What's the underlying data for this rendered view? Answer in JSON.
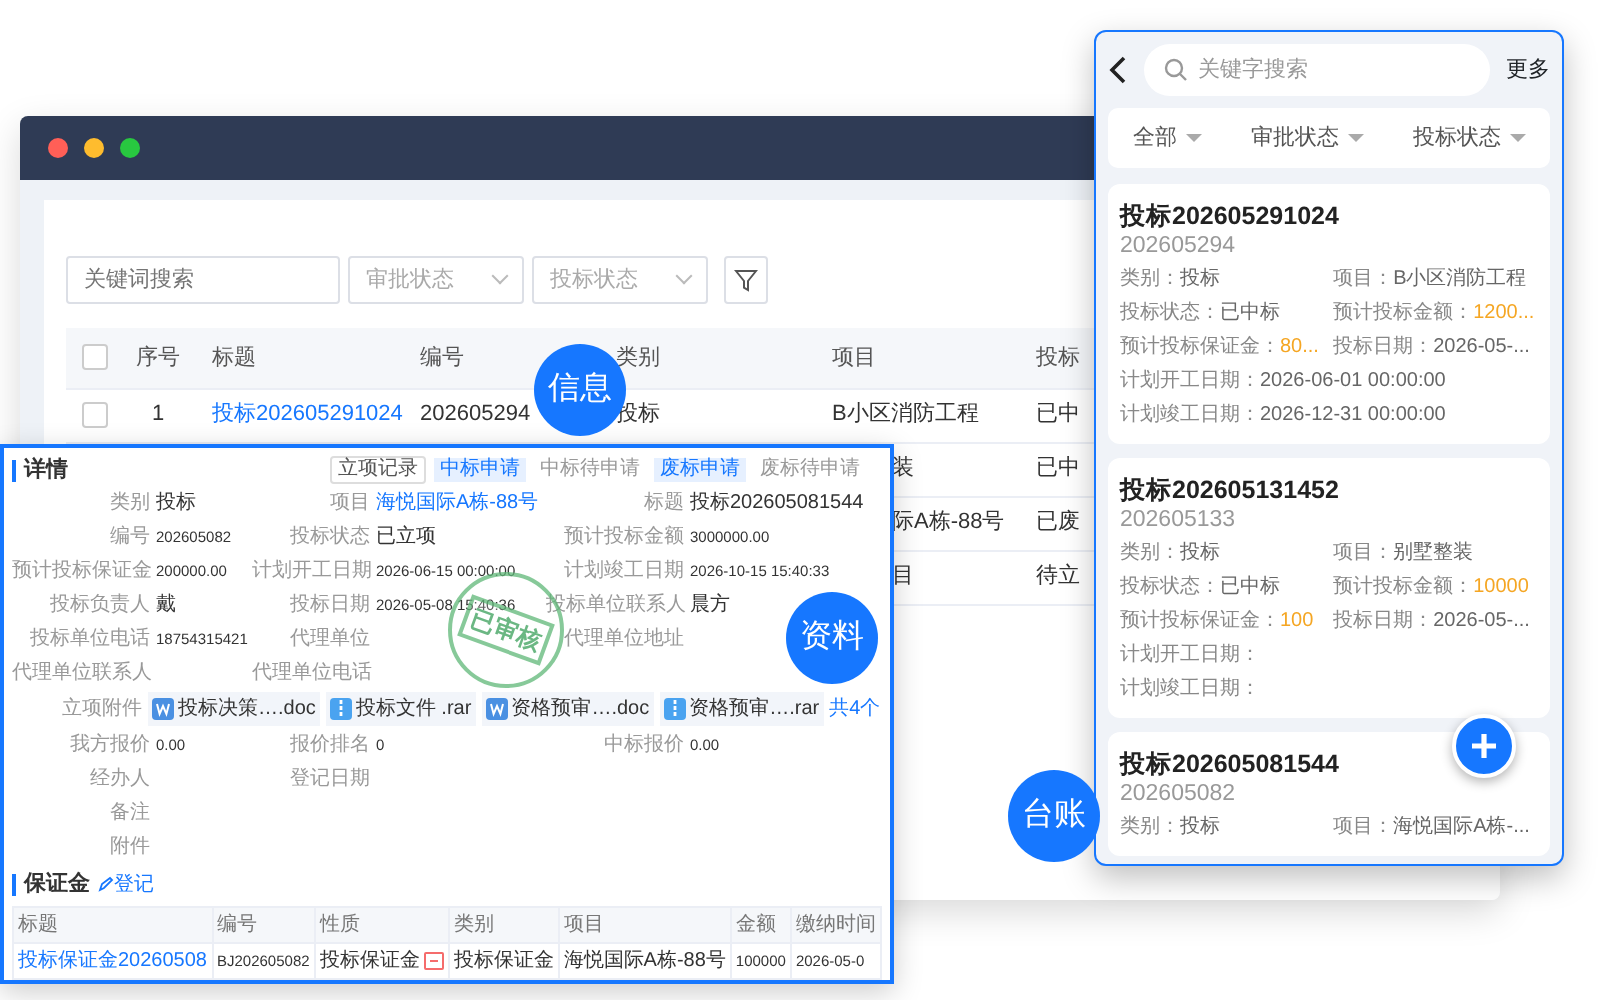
{
  "desktop": {
    "search": {
      "placeholder": "关键词搜索"
    },
    "selects": [
      {
        "placeholder": "审批状态"
      },
      {
        "placeholder": "投标状态"
      }
    ],
    "table": {
      "header_checked": false,
      "columns": [
        "序号",
        "标题",
        "编号",
        "类别",
        "项目",
        "投标"
      ],
      "rows": [
        {
          "checked": false,
          "index": "1",
          "title": "投标202605291024",
          "number": "202605294",
          "category": "投标",
          "project": "B小区消防工程",
          "status": "已中"
        },
        {
          "project": "装",
          "status": "已中"
        },
        {
          "project": "际A栋-88号",
          "status": "已废"
        },
        {
          "project": "目",
          "status": "待立"
        }
      ]
    }
  },
  "detail": {
    "title": "详情",
    "actions": [
      {
        "kind": "button",
        "label": "立项记录"
      },
      {
        "kind": "tag",
        "label": "中标申请"
      },
      {
        "kind": "text",
        "label": "中标待申请"
      },
      {
        "kind": "tag",
        "label": "废标申请"
      },
      {
        "kind": "text",
        "label": "废标待申请"
      }
    ],
    "fields_top": [
      [
        {
          "label": "类别",
          "value": "投标"
        },
        {
          "label": "项目",
          "value": "海悦国际A栋-88号",
          "link": true
        },
        {
          "label": "标题",
          "value": "投标202605081544"
        }
      ],
      [
        {
          "label": "编号",
          "value": "202605082"
        },
        {
          "label": "投标状态",
          "value": "已立项"
        },
        {
          "label": "预计投标金额",
          "value": "3000000.00"
        }
      ],
      [
        {
          "label": "预计投标保证金",
          "value": "200000.00"
        },
        {
          "label": "计划开工日期",
          "value": "2026-06-15 00:00:00"
        },
        {
          "label": "计划竣工日期",
          "value": "2026-10-15 15:40:33"
        }
      ],
      [
        {
          "label": "投标负责人",
          "value": "戴"
        },
        {
          "label": "投标日期",
          "value": "2026-05-08 15:40:36"
        },
        {
          "label": "投标单位联系人",
          "value": "晨方"
        }
      ],
      [
        {
          "label": "投标单位电话",
          "value": "18754315421"
        },
        {
          "label": "代理单位"
        },
        {
          "label": "代理单位地址"
        }
      ],
      [
        {
          "label": "代理单位联系人"
        },
        {
          "label": "代理单位电话"
        }
      ]
    ],
    "attachments": {
      "label": "立项附件",
      "files": [
        {
          "kind": "doc",
          "name": "投标决策….doc"
        },
        {
          "kind": "zip",
          "name": "投标文件 .rar"
        },
        {
          "kind": "doc",
          "name": "资格预审….doc"
        },
        {
          "kind": "zip",
          "name": "资格预审….rar"
        }
      ],
      "more": "共4个"
    },
    "fields_bottom": [
      [
        {
          "label": "我方报价",
          "value": "0.00"
        },
        {
          "label": "报价排名",
          "value": "0"
        },
        {
          "label": "中标报价",
          "value": "0.00"
        }
      ],
      [
        {
          "label": "经办人"
        },
        {
          "label": "登记日期"
        }
      ],
      [
        {
          "label": "备注"
        }
      ],
      [
        {
          "label": "附件"
        }
      ]
    ],
    "stamp": "已审核",
    "deposit": {
      "title": "保证金",
      "action": "登记",
      "columns": [
        "标题",
        "编号",
        "性质",
        "类别",
        "项目",
        "金额",
        "缴纳时间"
      ],
      "rows": [
        {
          "cells": [
            "投标保证金20260508",
            "BJ202605082",
            "投标保证金",
            "投标保证金",
            "海悦国际A栋-88号",
            "100000",
            "2026-05-0"
          ],
          "tag": true
        }
      ]
    }
  },
  "badges": [
    "信息",
    "资料",
    "台账"
  ],
  "mobile": {
    "search": {
      "placeholder": "关键字搜索"
    },
    "more": "更多",
    "filters": [
      "全部",
      "审批状态",
      "投标状态"
    ],
    "cards": [
      {
        "title": "投标202605291024",
        "number": "202605294",
        "rows": [
          [
            {
              "label": "类别：",
              "value": "投标"
            },
            {
              "label": "项目：",
              "value": "B小区消防工程"
            }
          ],
          [
            {
              "label": "投标状态：",
              "value": "已中标"
            },
            {
              "label": "预计投标金额：",
              "value": "1200...",
              "highlight": true
            }
          ],
          [
            {
              "label": "预计投标保证金：",
              "value": "80...",
              "highlight": true
            },
            {
              "label": "投标日期：",
              "value": "2026-05-..."
            }
          ],
          [
            {
              "label": "计划开工日期：",
              "value": "2026-06-01 00:00:00"
            }
          ],
          [
            {
              "label": "计划竣工日期：",
              "value": "2026-12-31 00:00:00"
            }
          ]
        ]
      },
      {
        "title": "投标202605131452",
        "number": "202605133",
        "rows": [
          [
            {
              "label": "类别：",
              "value": "投标"
            },
            {
              "label": "项目：",
              "value": "别墅整装"
            }
          ],
          [
            {
              "label": "投标状态：",
              "value": "已中标"
            },
            {
              "label": "预计投标金额：",
              "value": "10000",
              "highlight": true
            }
          ],
          [
            {
              "label": "预计投标保证金：",
              "value": "100",
              "highlight": true
            },
            {
              "label": "投标日期：",
              "value": "2026-05-..."
            }
          ],
          [
            {
              "label": "计划开工日期："
            }
          ],
          [
            {
              "label": "计划竣工日期："
            }
          ]
        ]
      },
      {
        "title": "投标202605081544",
        "number": "202605082",
        "rows": [
          [
            {
              "label": "类别：",
              "value": "投标"
            },
            {
              "label": "项目：",
              "value": "海悦国际A栋-..."
            }
          ]
        ]
      }
    ]
  }
}
